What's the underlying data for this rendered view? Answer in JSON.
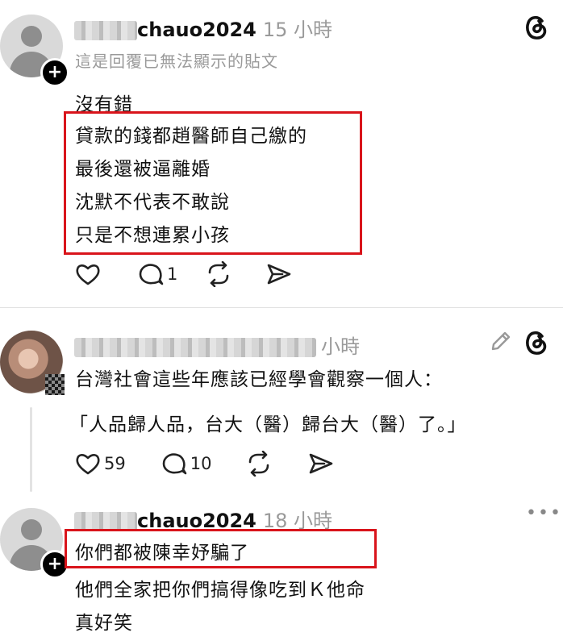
{
  "posts": [
    {
      "username": "chauo2024",
      "time": "15 小時",
      "reply_note": "這是回覆已無法顯示的貼文",
      "lines": [
        "沒有錯",
        "貸款的錢都趙醫師自己繳的",
        "最後還被逼離婚",
        "沈默不代表不敢說",
        "只是不想連累小孩"
      ],
      "actions": {
        "like_count": "",
        "comment_count": "1"
      }
    },
    {
      "username_suffix": "小時",
      "lines": [
        "台灣社會這些年應該已經學會觀察一個人：",
        "「人品歸人品，台大（醫）歸台大（醫）了。」"
      ],
      "actions": {
        "like_count": "59",
        "comment_count": "10"
      }
    },
    {
      "username": "chauo2024",
      "time": "18 小時",
      "lines": [
        "你們都被陳幸妤騙了",
        "他們全家把你們搞得像吃到Ｋ他命",
        "真好笑"
      ]
    }
  ],
  "icons": [
    "threads-icon",
    "heart-icon",
    "comment-icon",
    "repost-icon",
    "share-icon",
    "edit-icon",
    "more-icon"
  ],
  "colors": {
    "highlight_box": "#d9141b",
    "muted_text": "#9a9a9a"
  }
}
